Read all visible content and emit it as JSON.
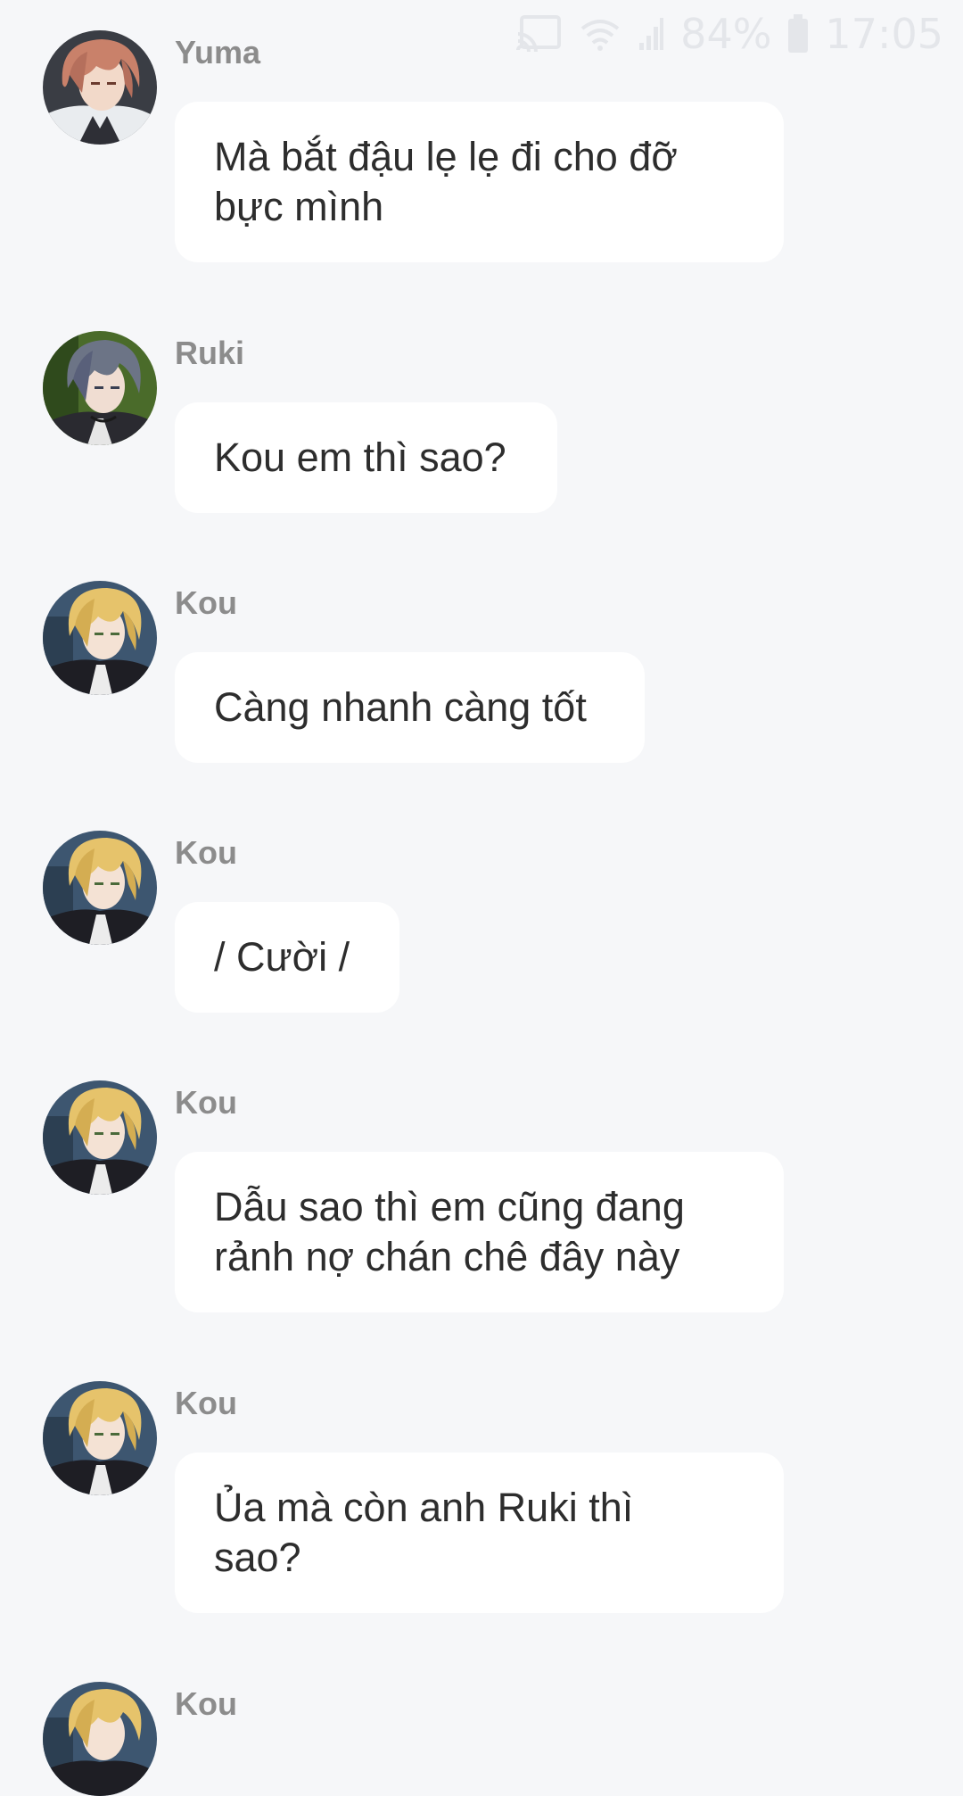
{
  "status_bar": {
    "battery_percent": "84%",
    "time": "17:05",
    "icons": [
      "cast-icon",
      "wifi-icon",
      "signal-icon",
      "battery-icon"
    ]
  },
  "colors": {
    "background": "#f6f7f9",
    "bubble": "#ffffff",
    "sender_name": "#8c8c8c",
    "message_text": "#2d2d2d"
  },
  "messages": [
    {
      "sender": "Yuma",
      "text": "Mà bắt đậu lẹ lẹ đi cho đỡ\nbực mình",
      "avatar": "yuma-avatar"
    },
    {
      "sender": "Ruki",
      "text": "Kou em thì sao?",
      "avatar": "ruki-avatar"
    },
    {
      "sender": "Kou",
      "text": "Càng nhanh càng tốt",
      "avatar": "kou-avatar"
    },
    {
      "sender": "Kou",
      "text": "/ Cười /",
      "avatar": "kou-avatar"
    },
    {
      "sender": "Kou",
      "text": "Dẫu sao thì em cũng đang\nrảnh nợ chán chê đây này",
      "avatar": "kou-avatar"
    },
    {
      "sender": "Kou",
      "text": "Ủa mà còn anh Ruki thì\nsao?",
      "avatar": "kou-avatar"
    },
    {
      "sender": "Kou",
      "text": "",
      "avatar": "kou-avatar"
    }
  ]
}
